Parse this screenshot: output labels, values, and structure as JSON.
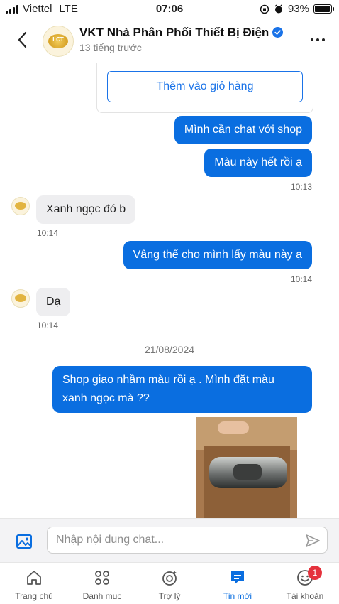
{
  "status_bar": {
    "carrier": "Viettel",
    "network": "LTE",
    "time": "07:06",
    "battery": "93%"
  },
  "header": {
    "shop_name": "VKT Nhà Phân Phối Thiết Bị Điện",
    "last_seen": "13 tiếng trước",
    "avatar_text": "LCT"
  },
  "product_card": {
    "add_to_cart_label": "Thêm vào giỏ hàng"
  },
  "messages": [
    {
      "side": "out",
      "text": "Mình cần chat với shop"
    },
    {
      "side": "out",
      "text": "Màu này hết rồi ạ",
      "time": "10:13"
    },
    {
      "side": "in",
      "text": "Xanh ngọc đó b",
      "time": "10:14"
    },
    {
      "side": "out",
      "text": "Vâng thế cho mình lấy màu này ạ",
      "time": "10:14"
    },
    {
      "side": "in",
      "text": "Dạ",
      "time": "10:14"
    },
    {
      "side": "out",
      "line1": "Shop giao nhầm màu rồi ạ . Mình đặt màu",
      "line2": "xanh ngọc mà ??"
    }
  ],
  "date_separator": "21/08/2024",
  "input": {
    "placeholder": "Nhập nội dung chat..."
  },
  "bottom_nav": [
    {
      "label": "Trang chủ",
      "icon": "home-icon"
    },
    {
      "label": "Danh mục",
      "icon": "grid-icon"
    },
    {
      "label": "Trợ lý",
      "icon": "assistant-icon"
    },
    {
      "label": "Tin mới",
      "icon": "chat-icon",
      "active": true
    },
    {
      "label": "Tài khoản",
      "icon": "smiley-icon",
      "badge": "1"
    }
  ],
  "colors": {
    "accent": "#0a6ee0",
    "incoming_bubble": "#eeeef0",
    "badge": "#e5323d"
  }
}
